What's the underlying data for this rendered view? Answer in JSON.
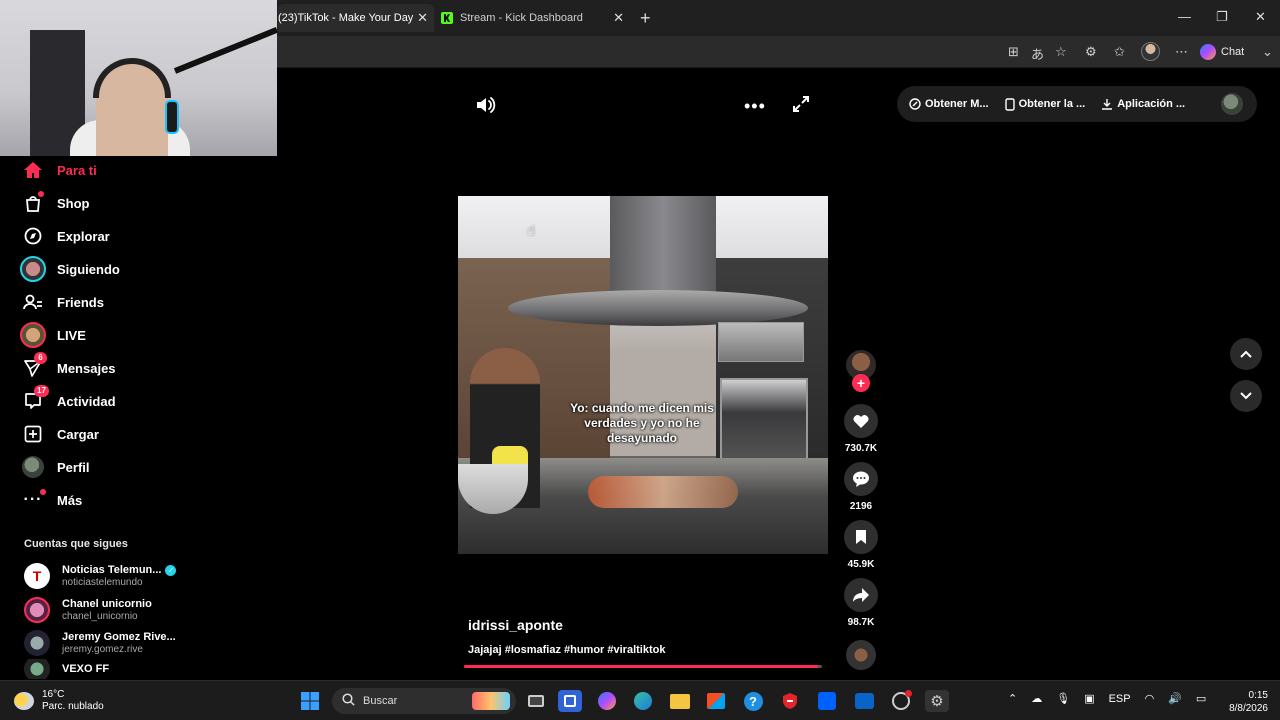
{
  "browser": {
    "tabs": [
      {
        "label": "(23)TikTok - Make Your Day",
        "active": true
      },
      {
        "label": "Stream - Kick Dashboard",
        "active": false
      }
    ],
    "chat_label": "Chat"
  },
  "sidebar": {
    "items": [
      {
        "label": "Para ti",
        "icon": "home-icon",
        "active": true
      },
      {
        "label": "Shop",
        "icon": "shopping-bag-icon"
      },
      {
        "label": "Explorar",
        "icon": "compass-icon"
      },
      {
        "label": "Siguiendo",
        "icon": "following-avatar-icon"
      },
      {
        "label": "Friends",
        "icon": "friends-icon"
      },
      {
        "label": "LIVE",
        "icon": "live-avatar-icon"
      },
      {
        "label": "Mensajes",
        "icon": "paper-plane-icon",
        "badge": "6"
      },
      {
        "label": "Actividad",
        "icon": "activity-icon",
        "badge": "17"
      },
      {
        "label": "Cargar",
        "icon": "upload-plus-icon"
      },
      {
        "label": "Perfil",
        "icon": "profile-avatar-icon"
      },
      {
        "label": "Más",
        "icon": "more-dots-icon"
      }
    ],
    "following_title": "Cuentas que sigues",
    "accounts": [
      {
        "name": "Noticias Telemun...",
        "username": "noticiastelemundo",
        "verified": true
      },
      {
        "name": "Chanel unicornio",
        "username": "chanel_unicornio"
      },
      {
        "name": "Jeremy Gomez Rive...",
        "username": "jeremy.gomez.rive"
      },
      {
        "name": "VEXO FF",
        "username": ""
      }
    ]
  },
  "top_pill": {
    "items": [
      "Obtener M...",
      "Obtener la ...",
      "Aplicación ..."
    ]
  },
  "video": {
    "caption": "Yo: cuando me dicen mis verdades y yo no he desayunado",
    "author": "idrissi_aponte",
    "description": "Jajajaj #losmafiaz #humor #viraltiktok",
    "progress": 0.99
  },
  "actions": {
    "likes": "730.7K",
    "comments": "2196",
    "saves": "45.9K",
    "shares": "98.7K"
  },
  "taskbar": {
    "temperature": "16°C",
    "weather": "Parc. nublado",
    "search_placeholder": "Buscar",
    "language": "ESP",
    "time": "0:15",
    "date": "8/8/2026"
  },
  "colors": {
    "accent": "#fe2c55",
    "verified": "#20d5ec"
  }
}
